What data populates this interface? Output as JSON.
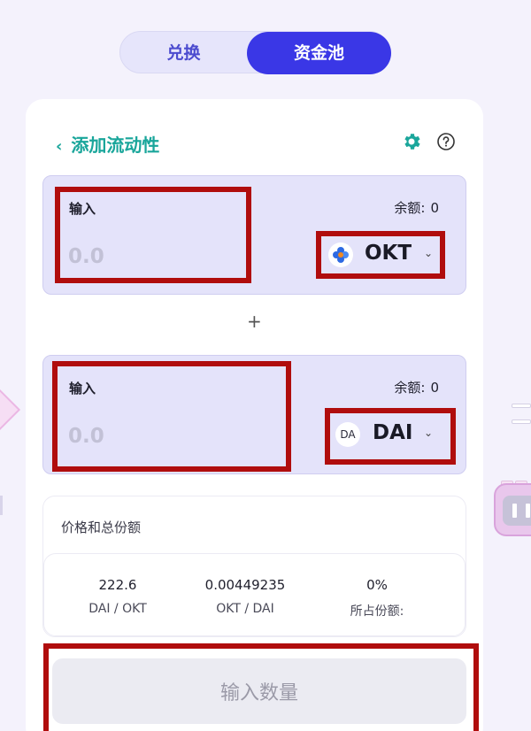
{
  "tabs": {
    "swap_label": "兑换",
    "pool_label": "资金池",
    "active": "pool"
  },
  "header": {
    "back_label": "添加流动性",
    "settings_icon": "gear-icon",
    "help_icon": "question-circle-icon",
    "accent_color": "#1aa69b"
  },
  "input_a": {
    "label": "输入",
    "balance_label": "余额:",
    "balance_value": "0",
    "placeholder": "0.0",
    "token": {
      "symbol": "OKT",
      "icon": "okt-logo-icon"
    }
  },
  "plus_sign": "+",
  "input_b": {
    "label": "输入",
    "balance_label": "余额:",
    "balance_value": "0",
    "placeholder": "0.0",
    "token": {
      "symbol": "DAI",
      "icon": "dai-logo-icon",
      "icon_text": "DA"
    }
  },
  "price": {
    "title": "价格和总份额",
    "stats": [
      {
        "value": "222.6",
        "label": "DAI / OKT"
      },
      {
        "value": "0.00449235",
        "label": "OKT / DAI"
      },
      {
        "value": "0%",
        "label": "所占份额:"
      }
    ]
  },
  "submit": {
    "label": "输入数量"
  },
  "colors": {
    "primary": "#3a37e6",
    "highlight": "#b00d0d",
    "panel": "#e4e3fa"
  }
}
